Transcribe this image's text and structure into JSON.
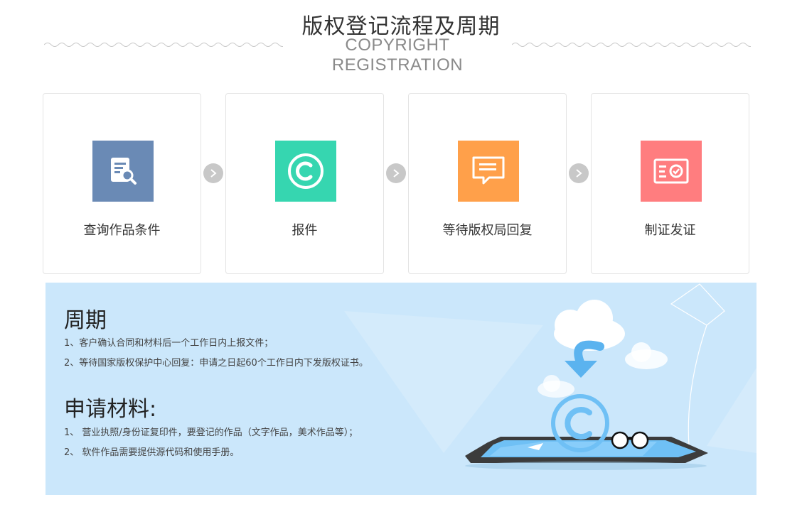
{
  "header": {
    "title_cn": "版权登记流程及周期",
    "title_en": "COPYRIGHT REGISTRATION"
  },
  "steps": [
    {
      "label": "查询作品条件",
      "icon": "document-search-icon",
      "color": "#6a8ab5"
    },
    {
      "label": "报件",
      "icon": "copyright-icon",
      "color": "#36d6b0"
    },
    {
      "label": "等待版权局回复",
      "icon": "message-icon",
      "color": "#ffa04a"
    },
    {
      "label": "制证发证",
      "icon": "certificate-icon",
      "color": "#ff7d7f"
    }
  ],
  "cycle": {
    "title": "周期",
    "lines": [
      "1、客户确认合同和材料后一个工作日内上报文件；",
      "2、等待国家版权保护中心回复：申请之日起60个工作日内下发版权证书。"
    ]
  },
  "materials": {
    "title": "申请材料:",
    "lines": [
      "1、 营业执照/身份证复印件，要登记的作品（文字作品，美术作品等）；",
      "2、 软件作品需要提供源代码和使用手册。"
    ]
  },
  "colors": {
    "panel_bg": "#cbe7fb",
    "accent_blue": "#6fc0f5",
    "arrow_gray": "#c8c8c8"
  }
}
